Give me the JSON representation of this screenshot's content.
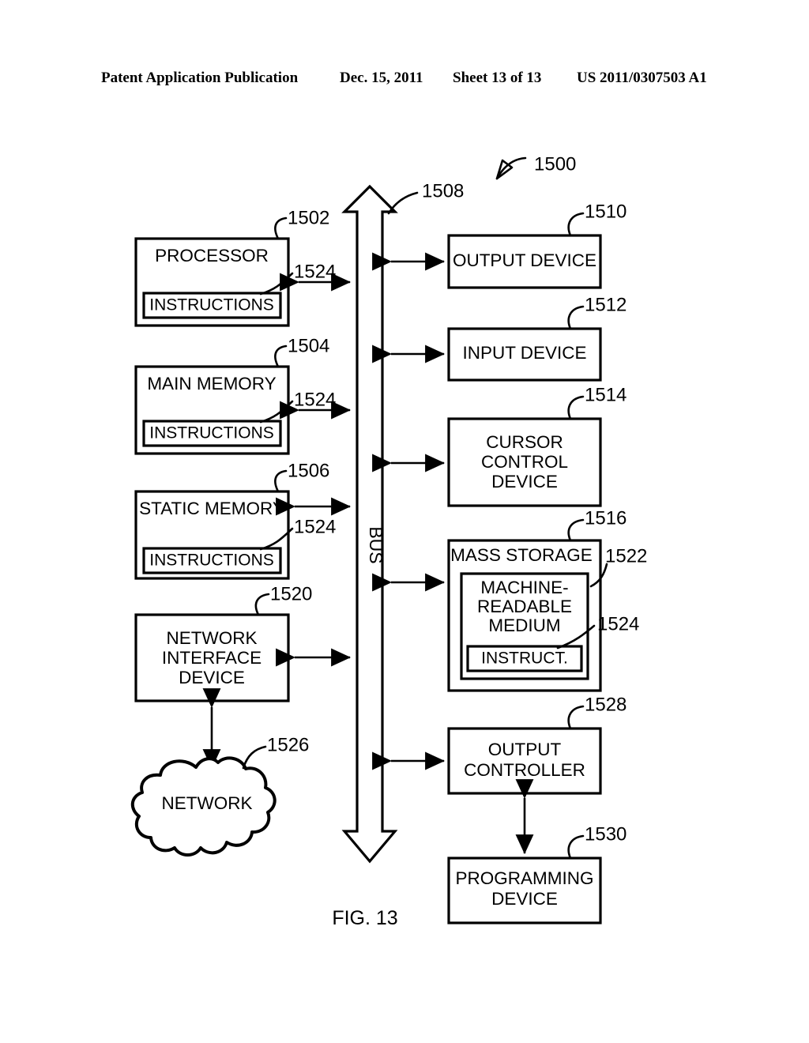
{
  "header": {
    "publication": "Patent Application Publication",
    "date": "Dec. 15, 2011",
    "sheet": "Sheet 13 of 13",
    "patent_number": "US 2011/0307503 A1"
  },
  "figure": {
    "caption": "FIG. 13",
    "system_ref": "1500",
    "bus_label": "BUS",
    "bus_ref": "1508"
  },
  "blocks": {
    "processor": {
      "label": "PROCESSOR",
      "ref": "1502",
      "inner_label": "INSTRUCTIONS",
      "inner_ref": "1524"
    },
    "main_memory": {
      "label": "MAIN MEMORY",
      "ref": "1504",
      "inner_label": "INSTRUCTIONS",
      "inner_ref": "1524"
    },
    "static_memory": {
      "label": "STATIC MEMORY",
      "ref": "1506",
      "inner_label": "INSTRUCTIONS",
      "inner_ref": "1524"
    },
    "network_interface": {
      "label_line1": "NETWORK",
      "label_line2": "INTERFACE",
      "label_line3": "DEVICE",
      "ref": "1520"
    },
    "network_cloud": {
      "label": "NETWORK",
      "ref": "1526"
    },
    "output_device": {
      "label": "OUTPUT DEVICE",
      "ref": "1510"
    },
    "input_device": {
      "label": "INPUT DEVICE",
      "ref": "1512"
    },
    "cursor_control": {
      "label_line1": "CURSOR",
      "label_line2": "CONTROL",
      "label_line3": "DEVICE",
      "ref": "1514"
    },
    "mass_storage": {
      "label": "MASS STORAGE",
      "ref": "1516"
    },
    "machine_medium": {
      "label_line1": "MACHINE-",
      "label_line2": "READABLE",
      "label_line3": "MEDIUM",
      "ref": "1522"
    },
    "medium_instruct": {
      "label": "INSTRUCT.",
      "ref": "1524"
    },
    "output_controller": {
      "label_line1": "OUTPUT",
      "label_line2": "CONTROLLER",
      "ref": "1528"
    },
    "programming_device": {
      "label_line1": "PROGRAMMING",
      "label_line2": "DEVICE",
      "ref": "1530"
    }
  },
  "colors": {
    "ink": "#000000",
    "paper": "#ffffff"
  }
}
